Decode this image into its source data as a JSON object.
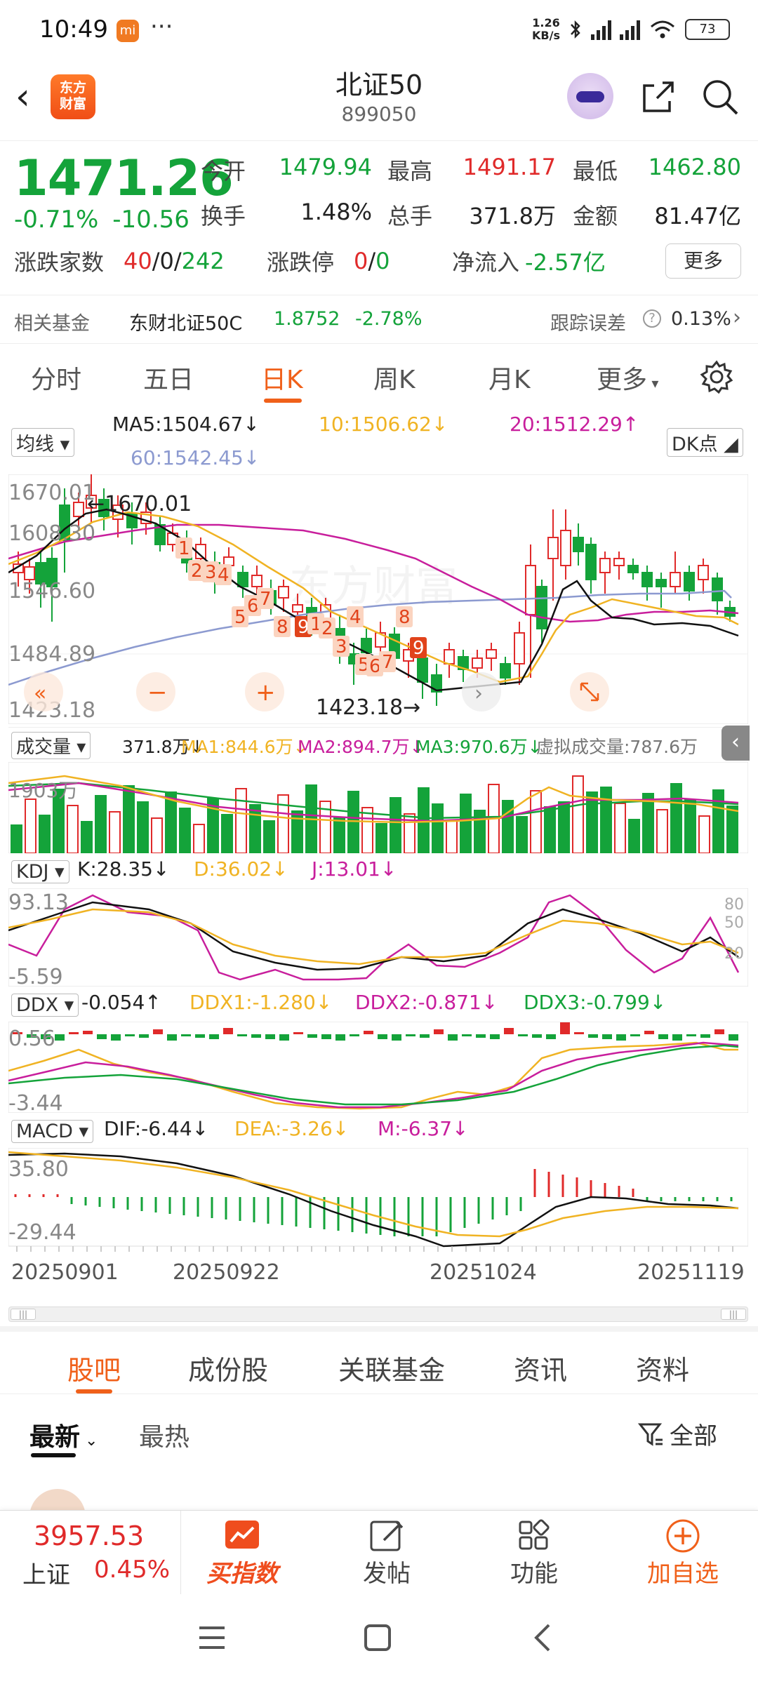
{
  "status": {
    "time": "10:49",
    "app_badge": "mi",
    "dots": "···",
    "speed_value": "1.26",
    "speed_unit": "KB/s",
    "battery": "73"
  },
  "header": {
    "title": "北证50",
    "code": "899050",
    "logo_line1": "东方",
    "logo_line2": "财富"
  },
  "quote": {
    "price": "1471.26",
    "change_pct": "-0.71%",
    "change_abs": "-10.56",
    "open_label": "今开",
    "open": "1479.94",
    "high_label": "最高",
    "high": "1491.17",
    "low_label": "最低",
    "low": "1462.80",
    "turnover_label": "换手",
    "turnover": "1.48%",
    "volume_label": "总手",
    "volume": "371.8万",
    "amount_label": "金额",
    "amount": "81.47亿",
    "updown_label": "涨跌家数",
    "up_count": "40",
    "sep1": "/",
    "flat_count": "0",
    "sep2": "/",
    "down_count": "242",
    "limit_label": "涨跌停",
    "limit_up": "0",
    "sep3": "/",
    "limit_down": "0",
    "netflow_label": "净流入",
    "netflow": "-2.57亿",
    "more": "更多"
  },
  "fund": {
    "label": "相关基金",
    "name": "东财北证50C",
    "nav": "1.8752",
    "pct": "-2.78%",
    "track_label": "跟踪误差",
    "track_value": "0.13%"
  },
  "tabs": [
    "分时",
    "五日",
    "日K",
    "周K",
    "月K",
    "更多"
  ],
  "chart": {
    "ma_select": "均线",
    "ma5": "MA5:1504.67",
    "ma10": "10:1506.62",
    "ma20": "20:1512.29",
    "ma60": "60:1542.45",
    "dk": "DK点",
    "y_labels": [
      "1670.01",
      "1608.30",
      "1546.60",
      "1484.89",
      "1423.18"
    ],
    "high_mark": "1670.01",
    "low_mark": "1423.18",
    "watermark": "东方财富",
    "vol_select": "成交量",
    "vol": "371.8万",
    "vol_ma1": "MA1:844.6万",
    "vol_ma2": "MA2:894.7万",
    "vol_ma3": "MA3:970.6万",
    "vol_virtual": "虚拟成交量:787.6万",
    "vol_y": "1903万",
    "kdj_select": "KDJ",
    "kdj_k": "K:28.35",
    "kdj_d": "D:36.02",
    "kdj_j": "J:13.01",
    "kdj_top": "93.13",
    "kdj_bottom": "-5.59",
    "kdj_levels": [
      "80",
      "50",
      "20"
    ],
    "ddx_select": "DDX",
    "ddx": "-0.054",
    "ddx1": "DDX1:-1.280",
    "ddx2": "DDX2:-0.871",
    "ddx3": "DDX3:-0.799",
    "ddx_top": "0.56",
    "ddx_bottom": "-3.44",
    "macd_select": "MACD",
    "dif": "DIF:-6.44",
    "dea": "DEA:-3.26",
    "m": "M:-6.37",
    "macd_top": "35.80",
    "macd_bottom": "-29.44",
    "dates": [
      "20250901",
      "20250922",
      "20251024",
      "20251119"
    ]
  },
  "chart_data": {
    "type": "candlestick",
    "ylim": [
      1423.18,
      1670.01
    ],
    "high": 1670.01,
    "low": 1423.18,
    "last": 1471.26,
    "date_ticks": [
      "20250901",
      "20250922",
      "20251024",
      "20251119"
    ],
    "ma": {
      "MA5": 1504.67,
      "MA10": 1506.62,
      "MA20": 1512.29,
      "MA60": 1542.45
    }
  },
  "bottom_tabs": [
    "股吧",
    "成份股",
    "关联基金",
    "资讯",
    "资料"
  ],
  "feed": {
    "latest": "最新",
    "hot": "最热",
    "all": "全部"
  },
  "bottom_bar": {
    "index_value": "3957.53",
    "index_name": "上证",
    "index_pct": "0.45%",
    "buy_index": "买指数",
    "post": "发帖",
    "functions": "功能",
    "add_watch": "加自选"
  }
}
